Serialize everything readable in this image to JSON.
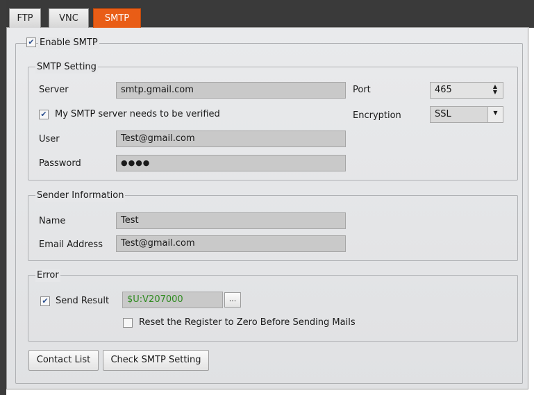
{
  "tabs": [
    {
      "label": "FTP"
    },
    {
      "label": "VNC"
    },
    {
      "label": "SMTP"
    }
  ],
  "enable_smtp": {
    "label": "Enable SMTP",
    "checked": true
  },
  "smtp_setting": {
    "title": "SMTP Setting",
    "server_label": "Server",
    "server_value": "smtp.gmail.com",
    "port_label": "Port",
    "port_value": "465",
    "verify_label": "My SMTP server needs to be verified",
    "verify_checked": true,
    "encryption_label": "Encryption",
    "encryption_value": "SSL",
    "user_label": "User",
    "user_value": "Test@gmail.com",
    "password_label": "Password",
    "password_value": "●●●●"
  },
  "sender": {
    "title": "Sender Information",
    "name_label": "Name",
    "name_value": "Test",
    "email_label": "Email Address",
    "email_value": "Test@gmail.com"
  },
  "error": {
    "title": "Error",
    "send_result_label": "Send Result",
    "send_result_checked": true,
    "register_value": "$U:V207000",
    "browse_label": "...",
    "reset_label": "Reset the Register to Zero Before Sending Mails",
    "reset_checked": false
  },
  "buttons": {
    "contact_list": "Contact List",
    "check_smtp": "Check SMTP Setting"
  },
  "icons": {
    "check": "checkmark-icon",
    "spinner": "spinner-arrows-icon",
    "dropdown": "chevron-down-icon"
  }
}
